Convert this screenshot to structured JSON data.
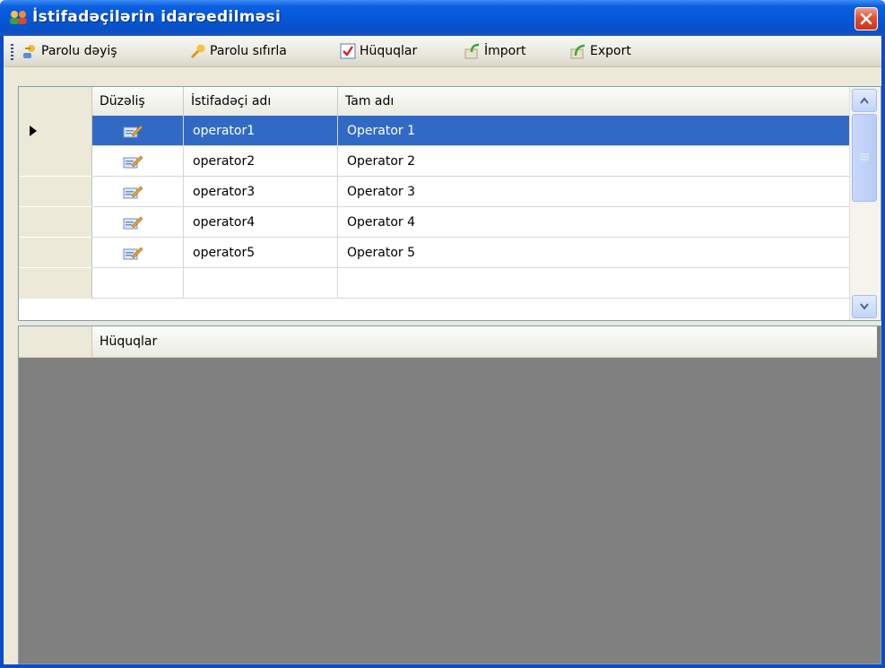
{
  "window": {
    "title": "İstifadəçilərin idarəedilməsi"
  },
  "toolbar": {
    "change_password": "Parolu dəyiş",
    "reset_password": "Parolu sıfırla",
    "rights": "Hüquqlar",
    "import": "İmport",
    "export": "Export"
  },
  "users_grid": {
    "columns": [
      "Düzəliş",
      "İstifadəçi adı",
      "Tam adı"
    ],
    "rows": [
      {
        "username": "operator1",
        "fullname": "Operator 1",
        "selected": true
      },
      {
        "username": "operator2",
        "fullname": "Operator 2"
      },
      {
        "username": "operator3",
        "fullname": "Operator 3"
      },
      {
        "username": "operator4",
        "fullname": "Operator 4"
      },
      {
        "username": "operator5",
        "fullname": "Operator 5"
      }
    ]
  },
  "rights_grid": {
    "columns": [
      "Hüquqlar"
    ]
  },
  "colors": {
    "titlebar": "#0458d8",
    "selection": "#316ac5",
    "empty_area": "#808080"
  }
}
